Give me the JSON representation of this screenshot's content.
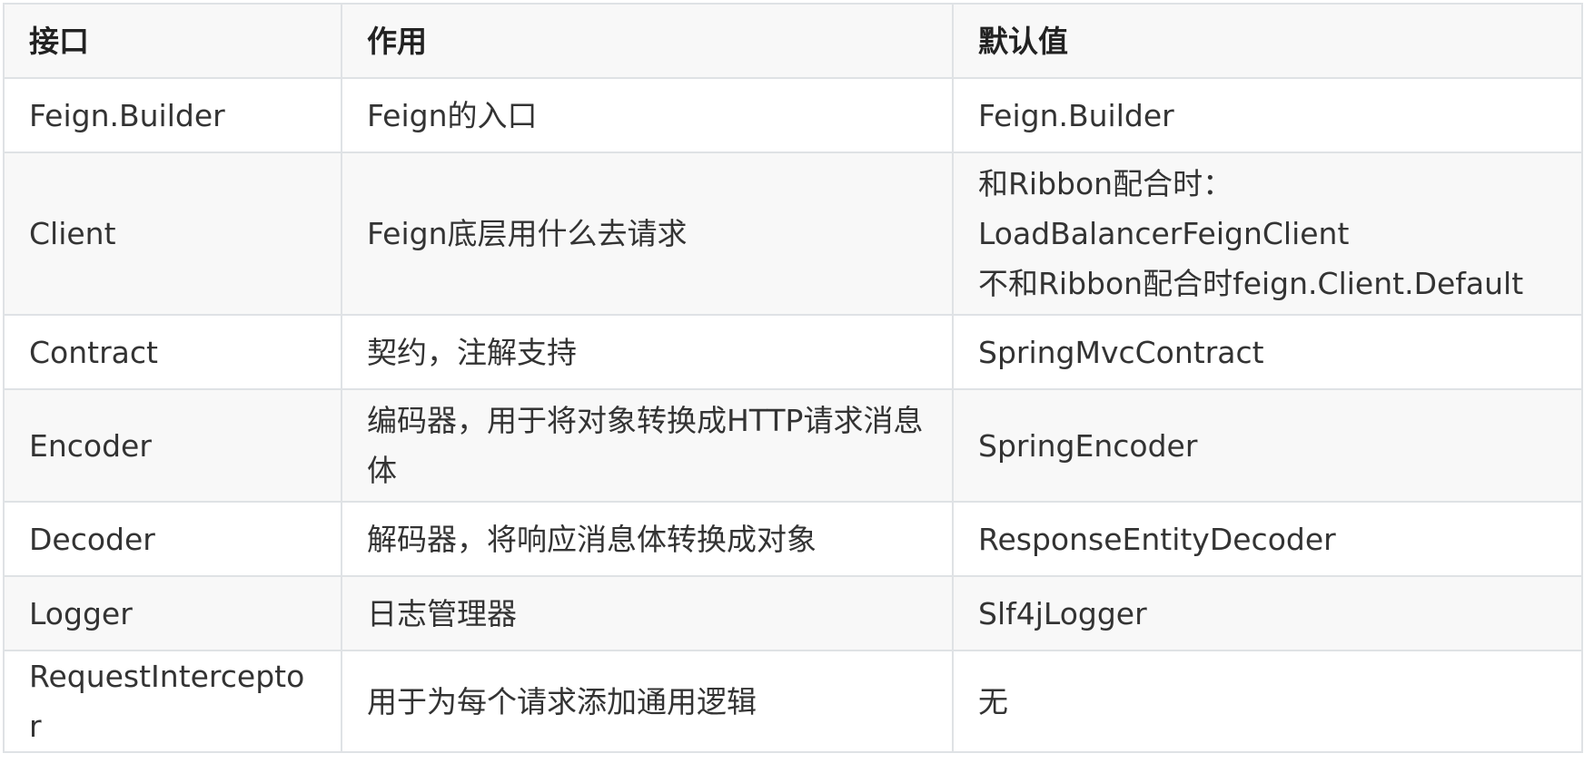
{
  "table": {
    "headers": [
      "接口",
      "作用",
      "默认值"
    ],
    "rows": [
      {
        "interface": "Feign.Builder",
        "purpose": "Feign的入口",
        "default_lines": [
          "Feign.Builder"
        ]
      },
      {
        "interface": "Client",
        "purpose": "Feign底层用什么去请求",
        "default_lines": [
          "和Ribbon配合时：",
          "LoadBalancerFeignClient",
          "不和Ribbon配合时feign.Client.Default"
        ]
      },
      {
        "interface": "Contract",
        "purpose": "契约，注解支持",
        "default_lines": [
          "SpringMvcContract"
        ]
      },
      {
        "interface": "Encoder",
        "purpose": "编码器，用于将对象转换成HTTP请求消息体",
        "default_lines": [
          "SpringEncoder"
        ]
      },
      {
        "interface": "Decoder",
        "purpose": "解码器，将响应消息体转换成对象",
        "default_lines": [
          "ResponseEntityDecoder"
        ]
      },
      {
        "interface": "Logger",
        "purpose": "日志管理器",
        "default_lines": [
          "Slf4jLogger"
        ]
      },
      {
        "interface": "RequestInterceptor",
        "purpose": "用于为每个请求添加通用逻辑",
        "default_lines": [
          "无"
        ]
      }
    ]
  }
}
